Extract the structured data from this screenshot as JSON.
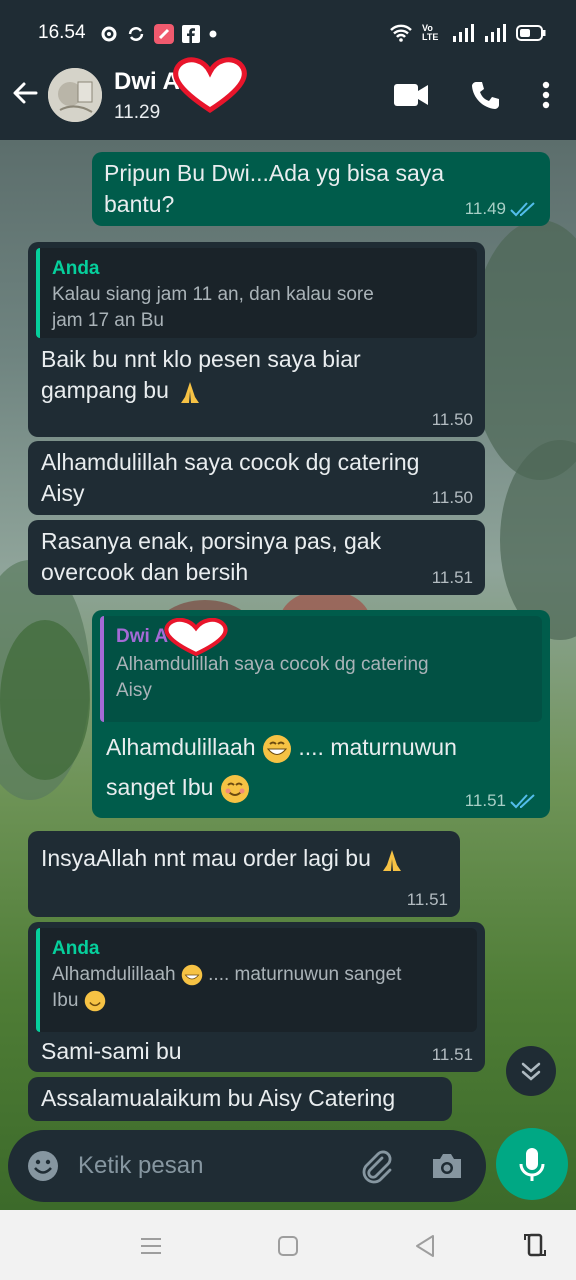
{
  "status_bar": {
    "time": "16.54",
    "network": "Vo LTE"
  },
  "header": {
    "contact_name": "Dwi A",
    "last_seen": "11.29"
  },
  "messages": [
    {
      "dir": "out",
      "text_1": "Pripun Bu Dwi...Ada yg bisa saya",
      "text_2": "bantu?",
      "time": "11.49"
    },
    {
      "dir": "in",
      "quote_author": "Anda",
      "quote_text_1": "Kalau siang jam 11 an, dan kalau sore",
      "quote_text_2": "jam 17 an Bu",
      "text_1": "Baik bu nnt klo pesen saya biar",
      "text_2": "gampang bu",
      "time": "11.50"
    },
    {
      "dir": "in",
      "text_1": "Alhamdulillah saya cocok dg catering",
      "text_2": "Aisy",
      "time": "11.50"
    },
    {
      "dir": "in",
      "text_1": "Rasanya enak, porsinya pas, gak",
      "text_2": "overcook dan bersih",
      "time": "11.51"
    },
    {
      "dir": "out",
      "quote_author": "Dwi A",
      "quote_text_1": "Alhamdulillah saya cocok dg catering",
      "quote_text_2": "Aisy",
      "text_1": "Alhamdulillaah",
      "text_1b": ".... maturnuwun",
      "text_2": "sanget Ibu",
      "time": "11.51"
    },
    {
      "dir": "in",
      "text_1": "InsyaAllah nnt mau order lagi bu",
      "time": "11.51"
    },
    {
      "dir": "in",
      "quote_author": "Anda",
      "quote_text_1": "Alhamdulillaah",
      "quote_text_1b": ".... maturnuwun sanget",
      "quote_text_2": "Ibu",
      "text_1": "Sami-sami bu",
      "time": "11.51"
    },
    {
      "dir": "in",
      "text_1": "Assalamualaikum bu Aisy Catering"
    }
  ],
  "input": {
    "placeholder": "Ketik pesan"
  },
  "colors": {
    "incoming": "#1f2c34",
    "outgoing": "#005c4b",
    "accent": "#00a884",
    "read_ticks": "#53bdeb"
  },
  "icons": [
    "back-arrow-icon",
    "video-call-icon",
    "phone-icon",
    "more-menu-icon",
    "emoji-icon",
    "attach-icon",
    "camera-icon",
    "mic-icon",
    "double-chevron-down-icon",
    "read-ticks-icon"
  ]
}
